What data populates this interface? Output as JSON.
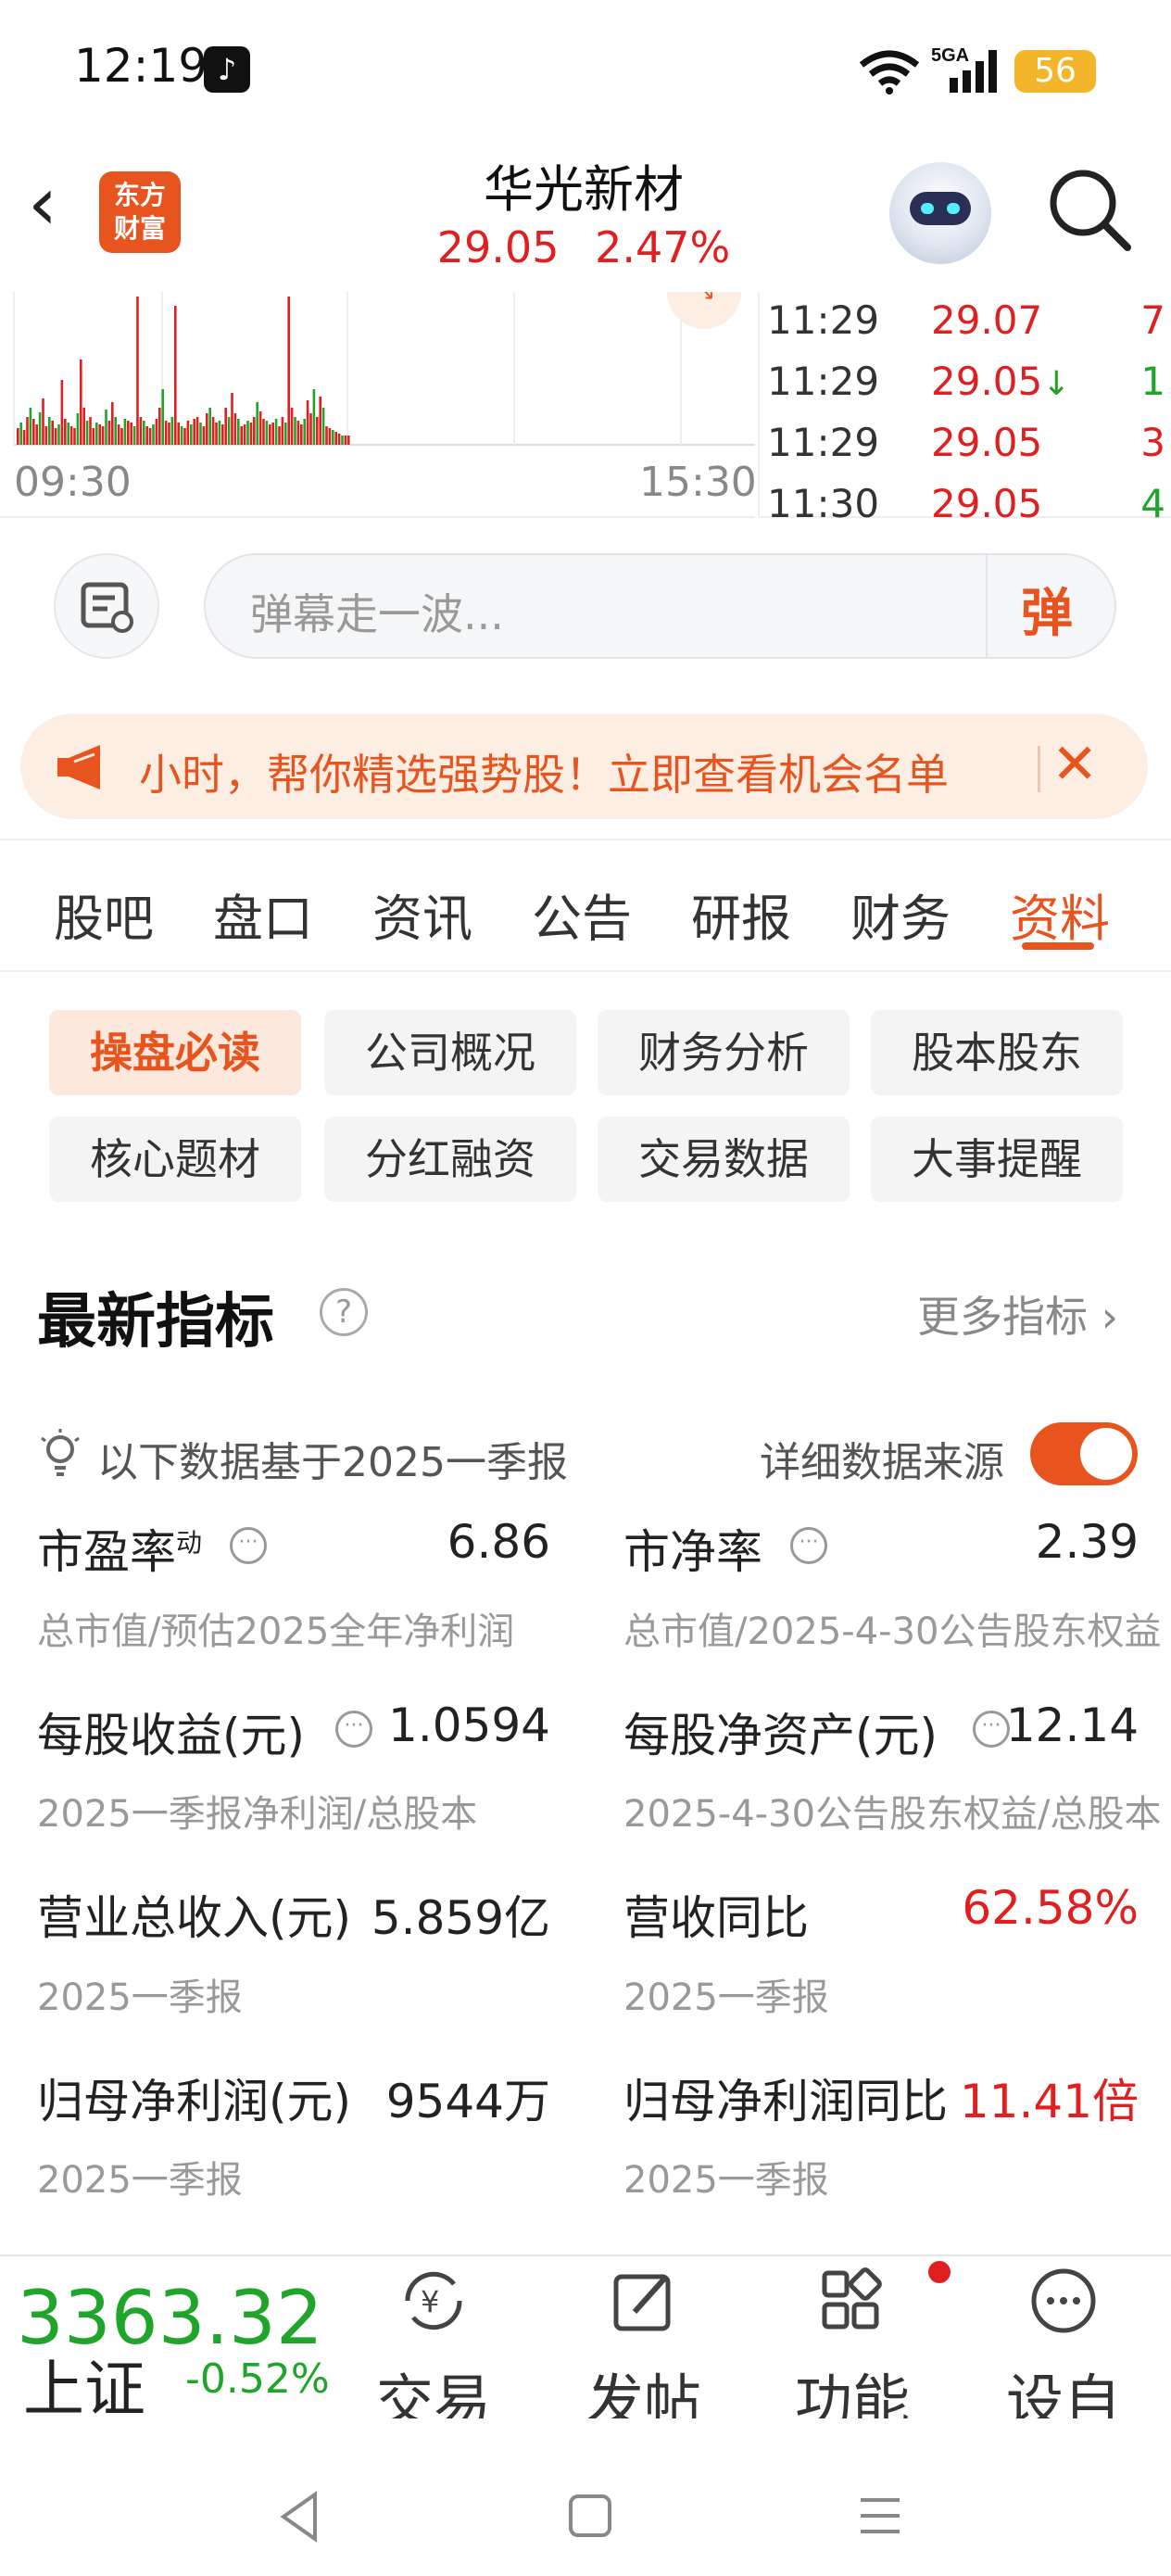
{
  "status_bar": {
    "time": "12:19",
    "signal_label": "5GA",
    "battery": "56"
  },
  "header": {
    "logo_line1": "东方",
    "logo_line2": "财富",
    "stock_name": "华光新材",
    "price": "29.05",
    "change_pct": "2.47%"
  },
  "chart": {
    "time_start": "09:30",
    "time_end": "15:30",
    "volume_bars": [
      18,
      24,
      16,
      30,
      40,
      28,
      22,
      35,
      50,
      20,
      30,
      26,
      18,
      22,
      70,
      28,
      24,
      20,
      18,
      34,
      92,
      40,
      26,
      30,
      18,
      24,
      22,
      20,
      38,
      26,
      46,
      30,
      22,
      18,
      28,
      26,
      24,
      20,
      160,
      30,
      26,
      20,
      18,
      22,
      28,
      40,
      60,
      26,
      24,
      30,
      150,
      24,
      20,
      18,
      26,
      22,
      28,
      30,
      24,
      20,
      34,
      40,
      30,
      24,
      26,
      22,
      40,
      30,
      56,
      34,
      28,
      20,
      22,
      26,
      24,
      30,
      46,
      36,
      28,
      26,
      22,
      24,
      28,
      20,
      30,
      24,
      160,
      40,
      30,
      26,
      22,
      28,
      48,
      34,
      60,
      30,
      52,
      40,
      20,
      18,
      16,
      14,
      12,
      10,
      10,
      10
    ]
  },
  "trade_ticks": [
    {
      "time": "11:29",
      "price": "29.07",
      "volume": "7",
      "dir": ""
    },
    {
      "time": "11:29",
      "price": "29.05",
      "volume": "1",
      "dir": "↓"
    },
    {
      "time": "11:29",
      "price": "29.05",
      "volume": "3",
      "dir": ""
    },
    {
      "time": "11:30",
      "price": "29.05",
      "volume": "4",
      "dir": ""
    }
  ],
  "barrage": {
    "placeholder": "弹幕走一波...",
    "button_label": "弹"
  },
  "notice": {
    "text": "小时，帮你精选强势股！立即查看机会名单"
  },
  "tabs": [
    "股吧",
    "盘口",
    "资讯",
    "公告",
    "研报",
    "财务",
    "资料"
  ],
  "sub_tabs": [
    "操盘必读",
    "公司概况",
    "财务分析",
    "股本股东",
    "核心题材",
    "分红融资",
    "交易数据",
    "大事提醒"
  ],
  "indicators": {
    "title": "最新指标",
    "help": "?",
    "more_label": "更多指标 ›",
    "basis_text": "以下数据基于2025一季报",
    "source_label": "详细数据来源",
    "items": [
      {
        "label": "市盈率",
        "sup": "动",
        "value": "6.86",
        "sub": "总市值/预估2025全年净利润"
      },
      {
        "label": "市净率",
        "sup": "",
        "value": "2.39",
        "sub": "总市值/2025-4-30公告股东权益"
      },
      {
        "label": "每股收益(元)",
        "sup": "",
        "value": "1.0594",
        "sub": "2025一季报净利润/总股本"
      },
      {
        "label": "每股净资产(元)",
        "sup": "",
        "value": "12.14",
        "sub": "2025-4-30公告股东权益/总股本"
      },
      {
        "label": "营业总收入(元)",
        "sup": "",
        "value": "5.859亿",
        "sub": "2025一季报"
      },
      {
        "label": "营收同比",
        "sup": "",
        "value": "62.58%",
        "sub": "2025一季报"
      },
      {
        "label": "归母净利润(元)",
        "sup": "",
        "value": "9544万",
        "sub": "2025一季报"
      },
      {
        "label": "归母净利润同比",
        "sup": "",
        "value": "11.41倍",
        "sub": "2025一季报"
      }
    ]
  },
  "bottom_nav": {
    "index_value": "3363.32",
    "index_name": "上证",
    "index_change": "-0.52%",
    "items": [
      "交易",
      "发帖",
      "功能",
      "设自选"
    ]
  },
  "colors": {
    "accent": "#e8541e",
    "up": "#e02020",
    "down": "#1fa62a"
  }
}
